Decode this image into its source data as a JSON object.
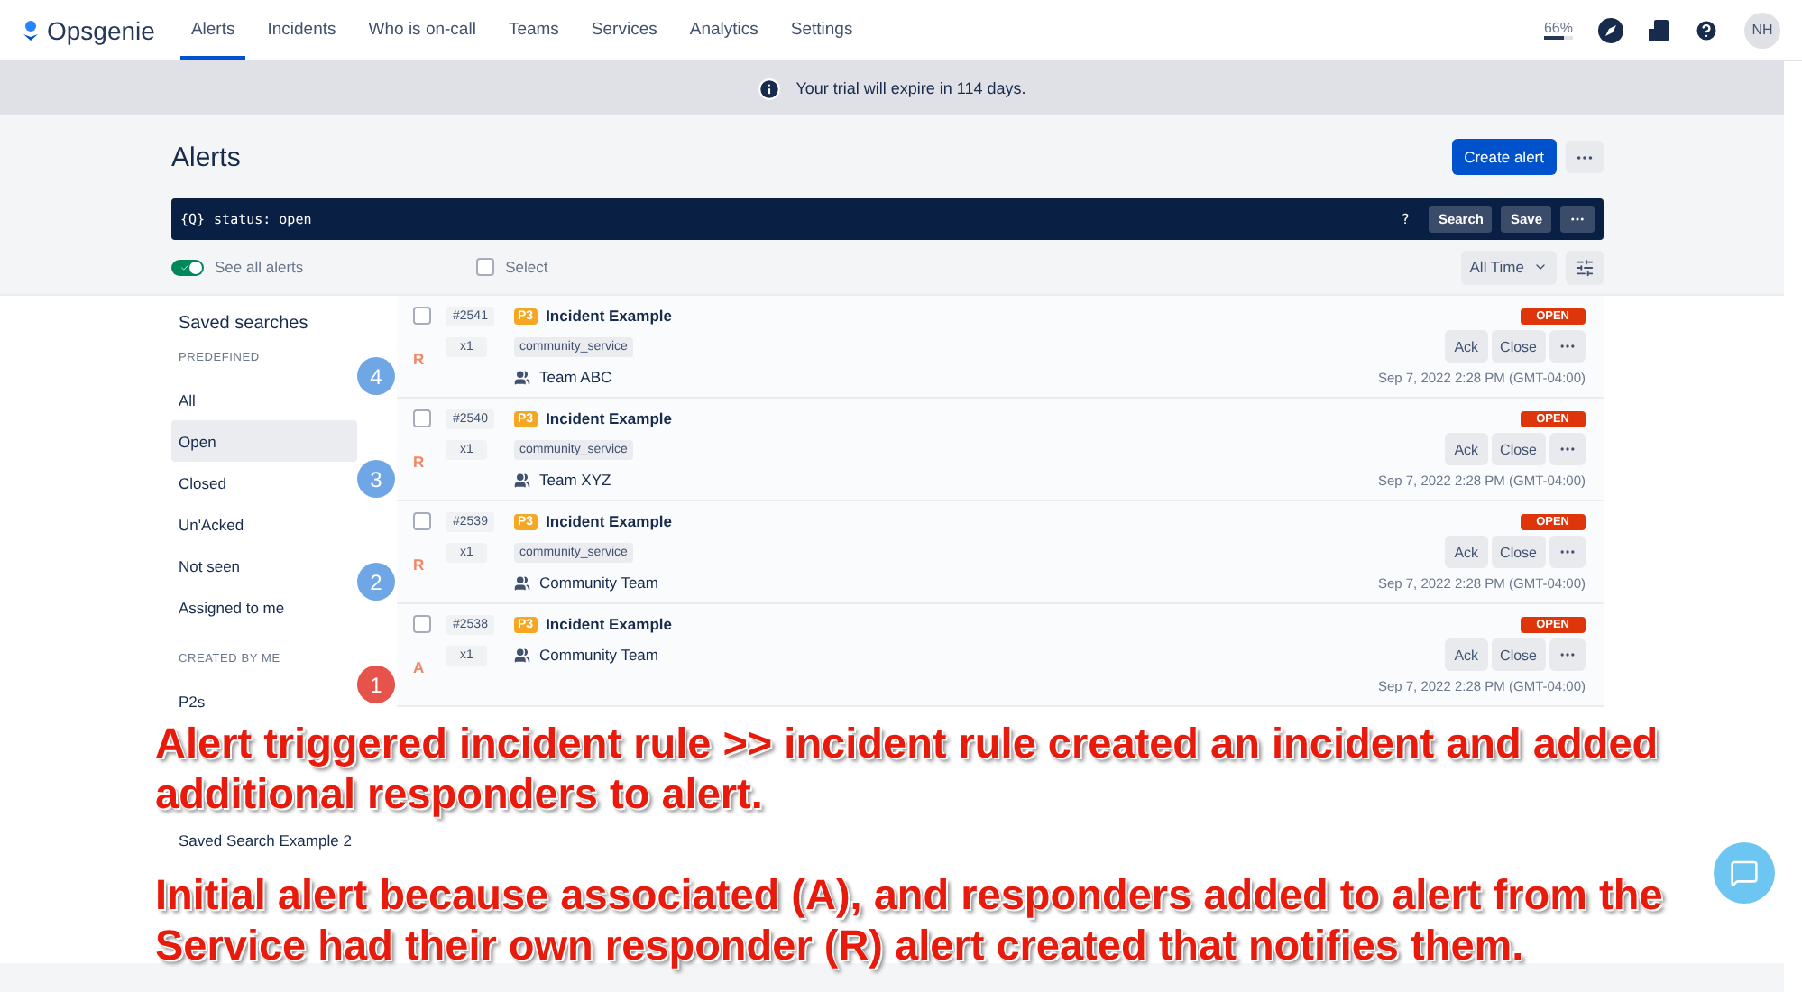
{
  "nav": {
    "logo": "Opsgenie",
    "tabs": [
      {
        "label": "Alerts",
        "selected": true
      },
      {
        "label": "Incidents",
        "selected": false
      },
      {
        "label": "Who is on-call",
        "selected": false
      },
      {
        "label": "Teams",
        "selected": false
      },
      {
        "label": "Services",
        "selected": false
      },
      {
        "label": "Analytics",
        "selected": false
      },
      {
        "label": "Settings",
        "selected": false
      }
    ],
    "progress": {
      "reading": "66%",
      "level": 0.66
    },
    "avatar": "NH"
  },
  "banner": {
    "text": "Your trial will expire in 114 days."
  },
  "page": {
    "title": "Alerts",
    "create_button": "Create alert"
  },
  "query_bar": {
    "prefix": "{Q}",
    "value": "status: open",
    "help": "?",
    "search_button": "Search",
    "save_button": "Save"
  },
  "toolbar": {
    "toggle": {
      "label": "See all alerts",
      "on": true
    },
    "select": {
      "label": "Select",
      "checked": false
    },
    "time_filter": "All Time"
  },
  "sidebar": {
    "title": "Saved searches",
    "sections": [
      {
        "heading": "PREDEFINED",
        "items": [
          {
            "label": "All",
            "selected": false
          },
          {
            "label": "Open",
            "selected": true
          },
          {
            "label": "Closed",
            "selected": false
          },
          {
            "label": "Un'Acked",
            "selected": false
          },
          {
            "label": "Not seen",
            "selected": false
          },
          {
            "label": "Assigned to me",
            "selected": false
          }
        ]
      },
      {
        "heading": "CREATED BY ME",
        "items": [
          {
            "label": "P2s",
            "selected": false
          },
          {
            "label": "Saved Search Example 2",
            "selected": false
          }
        ]
      }
    ]
  },
  "alerts": [
    {
      "id": "#2541",
      "count": "x1",
      "priority": "P3",
      "title": "Incident Example",
      "tag": "community_service",
      "team": "Team ABC",
      "status": "OPEN",
      "ack": "Ack",
      "close": "Close",
      "time": "Sep 7, 2022 2:28 PM (GMT-04:00)",
      "checked": false,
      "marker": {
        "number": "4",
        "color": "#6ea6e6",
        "letter": "R"
      }
    },
    {
      "id": "#2540",
      "count": "x1",
      "priority": "P3",
      "title": "Incident Example",
      "tag": "community_service",
      "team": "Team XYZ",
      "status": "OPEN",
      "ack": "Ack",
      "close": "Close",
      "time": "Sep 7, 2022 2:28 PM (GMT-04:00)",
      "checked": false,
      "marker": {
        "number": "3",
        "color": "#6ea6e6",
        "letter": "R"
      }
    },
    {
      "id": "#2539",
      "count": "x1",
      "priority": "P3",
      "title": "Incident Example",
      "tag": "community_service",
      "team": "Community Team",
      "status": "OPEN",
      "ack": "Ack",
      "close": "Close",
      "time": "Sep 7, 2022 2:28 PM (GMT-04:00)",
      "checked": false,
      "marker": {
        "number": "2",
        "color": "#6ea6e6",
        "letter": "R"
      }
    },
    {
      "id": "#2538",
      "count": "x1",
      "priority": "P3",
      "title": "Incident Example",
      "team": "Community Team",
      "status": "OPEN",
      "ack": "Ack",
      "close": "Close",
      "time": "Sep 7, 2022 2:28 PM (GMT-04:00)",
      "checked": false,
      "marker": {
        "number": "1",
        "color": "#e5534b",
        "letter": "A"
      }
    }
  ],
  "annotation": {
    "paragraphs": [
      "Alert triggered incident rule >> incident rule created an incident and added additional responders to alert.",
      "Initial alert because associated (A), and responders added to alert from the Service had their own responder (R) alert created that notifies them."
    ]
  }
}
